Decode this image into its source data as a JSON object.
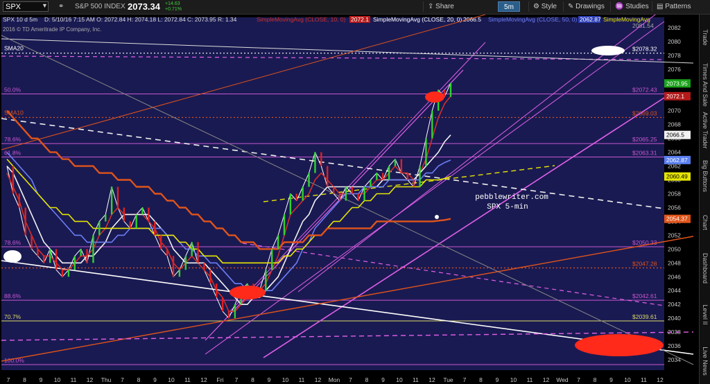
{
  "toolbar": {
    "symbol": "SPX",
    "index_name": "S&P 500 INDEX",
    "last_price": "2073.34",
    "change_abs": "+14.63",
    "change_pct": "+0.71%",
    "buttons": [
      "Share",
      "5m",
      "Style",
      "Drawings",
      "Studies",
      "Patterns"
    ]
  },
  "header": {
    "line1": "SPX 10 d 5m",
    "quote": "D: 5/10/16 7:15 AM  O: 2072.84  H: 2074.18  L: 2072.84  C: 2073.95  R: 1.34",
    "ma10": "SimpleMovingAvg (CLOSE, 10, 0)",
    "ma10_val": "2072.1",
    "ma20": "SimpleMovingAvg (CLOSE, 20, 0)",
    "ma20_val": "2066.5",
    "ma50": "SimpleMovingAvg (CLOSE, 50, 0)",
    "ma50_val": "2062.87",
    "ma_extra": "SimpleMovingAvg",
    "ma_extra_val": "2081.54",
    "copyright": "2016 © TD Ameritrade IP Company, Inc."
  },
  "side_tabs": [
    "Trade",
    "Times And Sales",
    "Active Trader",
    "Big Buttons",
    "Chart",
    "Dashboard",
    "Level II",
    "Live News"
  ],
  "chart_data": {
    "type": "line",
    "title": "",
    "xlabel": "",
    "ylabel": "",
    "ylim": [
      2032.5,
      2083.5
    ],
    "x_ticks": [
      "7",
      "8",
      "9",
      "10",
      "11",
      "12",
      "Thu",
      "7",
      "8",
      "9",
      "10",
      "11",
      "12",
      "Fri",
      "7",
      "8",
      "9",
      "10",
      "11",
      "12",
      "Mon",
      "7",
      "8",
      "9",
      "10",
      "11",
      "12",
      "Tue",
      "7",
      "8",
      "9",
      "10",
      "11",
      "12",
      "Wed",
      "7",
      "8",
      "9",
      "10",
      "11",
      "12"
    ],
    "y_ticks": [
      2034,
      2036,
      2038,
      2040,
      2042,
      2044,
      2046,
      2048,
      2050,
      2052,
      2054,
      2056,
      2058,
      2060,
      2062,
      2064,
      2066,
      2068,
      2070,
      2072,
      2074,
      2076,
      2078,
      2080,
      2082
    ],
    "price_badges": [
      {
        "label": "2073.95",
        "color": "#1aa31a"
      },
      {
        "label": "2072.1",
        "color": "#b51a1a"
      },
      {
        "label": "2066.5",
        "color": "#f2f2f2"
      },
      {
        "label": "2062.87",
        "color": "#5a7ff0"
      },
      {
        "label": "2060.49",
        "color": "#e6e600"
      },
      {
        "label": "2054.37",
        "color": "#e0541a"
      }
    ],
    "fib_levels": [
      {
        "pct": "50.0%",
        "value": 2072.43,
        "label": "$2072.43"
      },
      {
        "pct": "78.6%",
        "value": 2065.25,
        "label": "$2065.25"
      },
      {
        "pct": "61.8%",
        "value": 2063.31,
        "label": "$2063.31"
      },
      {
        "pct": "78.6%",
        "value": 2050.33,
        "label": "$2050.33"
      },
      {
        "pct": "88.6%",
        "value": 2042.61,
        "label": "$2042.61"
      },
      {
        "pct": "70.7%",
        "value": 2039.61,
        "label": "$2039.61"
      },
      {
        "pct": "100.0%",
        "value": 2033.3,
        "label": ""
      }
    ],
    "dotted_levels": [
      {
        "name": "SMA20",
        "value": 2078.32,
        "label": "$2078.32"
      },
      {
        "name": "SMA10",
        "value": 2069.03,
        "label": "$2069.03"
      },
      {
        "name": "",
        "value": 2047.28,
        "label": "$2047.28"
      }
    ],
    "annotation": [
      "pebblewriter.com",
      "SPX 5-min"
    ],
    "series": [
      {
        "name": "SPX",
        "color": "#ffffff",
        "values": [
          2062,
          2058,
          2056,
          2052,
          2050,
          2049,
          2048,
          2050,
          2047,
          2046,
          2047,
          2049,
          2050,
          2048,
          2052,
          2054,
          2055,
          2059,
          2056,
          2054,
          2053,
          2055,
          2056,
          2054,
          2052,
          2050,
          2049,
          2046,
          2047,
          2049,
          2051,
          2048,
          2047,
          2045,
          2043,
          2041,
          2040,
          2042,
          2044,
          2045,
          2043,
          2044,
          2047,
          2050,
          2052,
          2055,
          2058,
          2057,
          2059,
          2061,
          2064,
          2062,
          2059,
          2058,
          2057,
          2059,
          2058,
          2057,
          2059,
          2060,
          2061,
          2060,
          2062,
          2063,
          2061,
          2060,
          2059,
          2062,
          2066,
          2070,
          2073,
          2072,
          2074
        ]
      },
      {
        "name": "SimpleMovingAvg (CLOSE, 10, 0)",
        "color": "#d0302a",
        "values": [
          2061,
          2059,
          2057,
          2054,
          2052,
          2050,
          2049,
          2049,
          2048,
          2047,
          2047,
          2048,
          2049,
          2049,
          2050,
          2052,
          2053,
          2055,
          2056,
          2055,
          2055,
          2055,
          2055,
          2054,
          2053,
          2051,
          2050,
          2048,
          2047,
          2048,
          2049,
          2048,
          2047,
          2046,
          2044,
          2043,
          2041,
          2041,
          2042,
          2043,
          2044,
          2044,
          2045,
          2047,
          2049,
          2052,
          2055,
          2056,
          2057,
          2058,
          2060,
          2061,
          2060,
          2059,
          2058,
          2058,
          2058,
          2058,
          2058,
          2059,
          2060,
          2060,
          2061,
          2062,
          2061,
          2061,
          2060,
          2061,
          2063,
          2066,
          2069,
          2071,
          2072.1
        ]
      },
      {
        "name": "SimpleMovingAvg (CLOSE, 20, 0)",
        "color": "#f2f2f2",
        "values": [
          2062,
          2061,
          2059,
          2057,
          2055,
          2053,
          2051,
          2050,
          2049,
          2048,
          2048,
          2048,
          2048,
          2049,
          2049,
          2050,
          2051,
          2053,
          2054,
          2055,
          2055,
          2055,
          2055,
          2055,
          2054,
          2053,
          2052,
          2050,
          2049,
          2048,
          2048,
          2048,
          2048,
          2047,
          2046,
          2045,
          2044,
          2043,
          2042,
          2042,
          2043,
          2043,
          2044,
          2045,
          2046,
          2048,
          2050,
          2052,
          2054,
          2055,
          2057,
          2058,
          2059,
          2059,
          2059,
          2059,
          2059,
          2059,
          2059,
          2059,
          2059,
          2060,
          2060,
          2060,
          2060,
          2060,
          2060,
          2061,
          2062,
          2063,
          2064,
          2065.5,
          2066.5
        ]
      },
      {
        "name": "SimpleMovingAvg (CLOSE, 50, 0)",
        "color": "#6b7ff5",
        "values": [
          2064,
          2063,
          2062,
          2061,
          2060,
          2058,
          2057,
          2056,
          2055,
          2054,
          2053,
          2052,
          2052,
          2051,
          2051,
          2051,
          2051,
          2051,
          2052,
          2052,
          2053,
          2053,
          2053,
          2053,
          2053,
          2053,
          2052,
          2052,
          2051,
          2050,
          2050,
          2049,
          2049,
          2048,
          2048,
          2047,
          2046,
          2045,
          2045,
          2044,
          2044,
          2044,
          2044,
          2044,
          2045,
          2046,
          2047,
          2048,
          2050,
          2051,
          2053,
          2054,
          2055,
          2056,
          2057,
          2058,
          2058,
          2058,
          2059,
          2059,
          2059,
          2059,
          2060,
          2060,
          2060,
          2060,
          2060,
          2060,
          2061,
          2061,
          2062,
          2062.5,
          2062.87
        ]
      },
      {
        "name": "SMA yellow",
        "color": "#e6e600",
        "values": [
          2063,
          2062,
          2061,
          2060,
          2059,
          2058,
          2057,
          2056,
          2056,
          2055,
          2055,
          2054,
          2054,
          2054,
          2053,
          2053,
          2053,
          2053,
          2053,
          2053,
          2053,
          2053,
          2053,
          2053,
          2052,
          2052,
          2052,
          2052,
          2051,
          2051,
          2050,
          2050,
          2049,
          2049,
          2049,
          2048,
          2048,
          2048,
          2048,
          2048,
          2048,
          2048,
          2048,
          2048,
          2048,
          2049,
          2049,
          2050,
          2050,
          2051,
          2052,
          2052,
          2053,
          2054,
          2054,
          2055,
          2056,
          2056,
          2057,
          2057,
          2058,
          2058,
          2058,
          2059,
          2059,
          2059,
          2059,
          2059,
          2060,
          2060,
          2060,
          2060.2,
          2060.49
        ]
      },
      {
        "name": "SMA orange",
        "color": "#e0541a",
        "values": [
          2070,
          2069,
          2068,
          2067,
          2066,
          2066,
          2065,
          2064,
          2064,
          2063,
          2063,
          2062,
          2062,
          2062,
          2062,
          2061,
          2061,
          2061,
          2060,
          2060,
          2060,
          2059,
          2059,
          2059,
          2058,
          2058,
          2057,
          2057,
          2056,
          2056,
          2055,
          2055,
          2054,
          2054,
          2053,
          2053,
          2052,
          2052,
          2051,
          2051,
          2051,
          2050,
          2050,
          2050,
          2050,
          2051,
          2051,
          2051,
          2051,
          2052,
          2052,
          2052,
          2053,
          2053,
          2053,
          2053,
          2053,
          2053,
          2053,
          2053,
          2054,
          2054,
          2054,
          2054,
          2054,
          2054,
          2054,
          2054,
          2054,
          2054,
          2054.1,
          2054.2,
          2054.37
        ]
      }
    ]
  }
}
